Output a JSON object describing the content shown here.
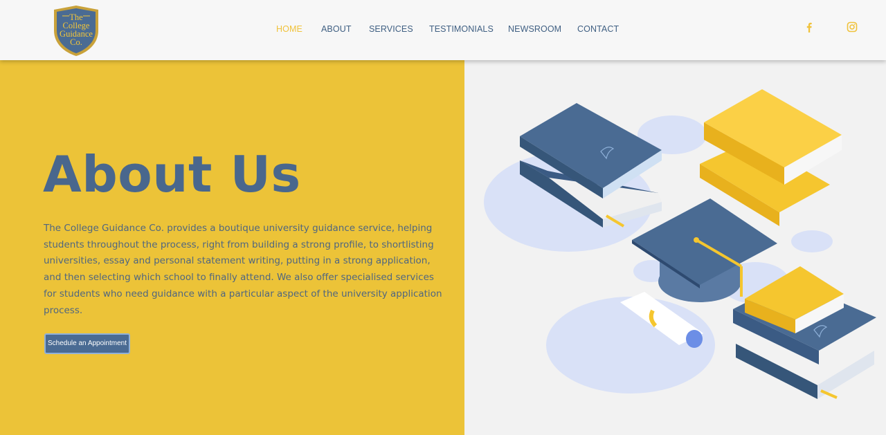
{
  "logo": {
    "line1": "The",
    "line2": "College",
    "line3": "Guidance",
    "line4": "Co.",
    "shield_color": "#4a6b93",
    "text_color": "#f3c63a"
  },
  "nav": {
    "items": [
      {
        "label": "HOME",
        "active": true
      },
      {
        "label": "ABOUT",
        "active": false
      },
      {
        "label": "SERVICES",
        "active": false
      },
      {
        "label": "TESTIMONIALS",
        "active": false
      },
      {
        "label": "NEWSROOM",
        "active": false
      },
      {
        "label": "CONTACT",
        "active": false
      }
    ]
  },
  "social": {
    "icons": [
      "facebook-icon",
      "instagram-icon"
    ],
    "color": "#f0c23b"
  },
  "hero": {
    "title": "About Us",
    "description": "The College Guidance Co. provides a boutique university guidance service, helping students throughout the process, right from building a strong profile, to shortlisting universities, essay and personal statement writing, putting in a strong application, and then selecting which school to finally attend. We also offer specialised services for students who need guidance with a particular aspect of the university application process.",
    "button_label": "Schedule an Appointment",
    "background_color": "#ecc338",
    "title_color": "#49678d"
  },
  "illustration": {
    "subject": "books-graduation-cap-diploma",
    "colors": {
      "blue": "#4a6b93",
      "yellow": "#f5c62f",
      "circle": "#d9e1f7"
    }
  }
}
